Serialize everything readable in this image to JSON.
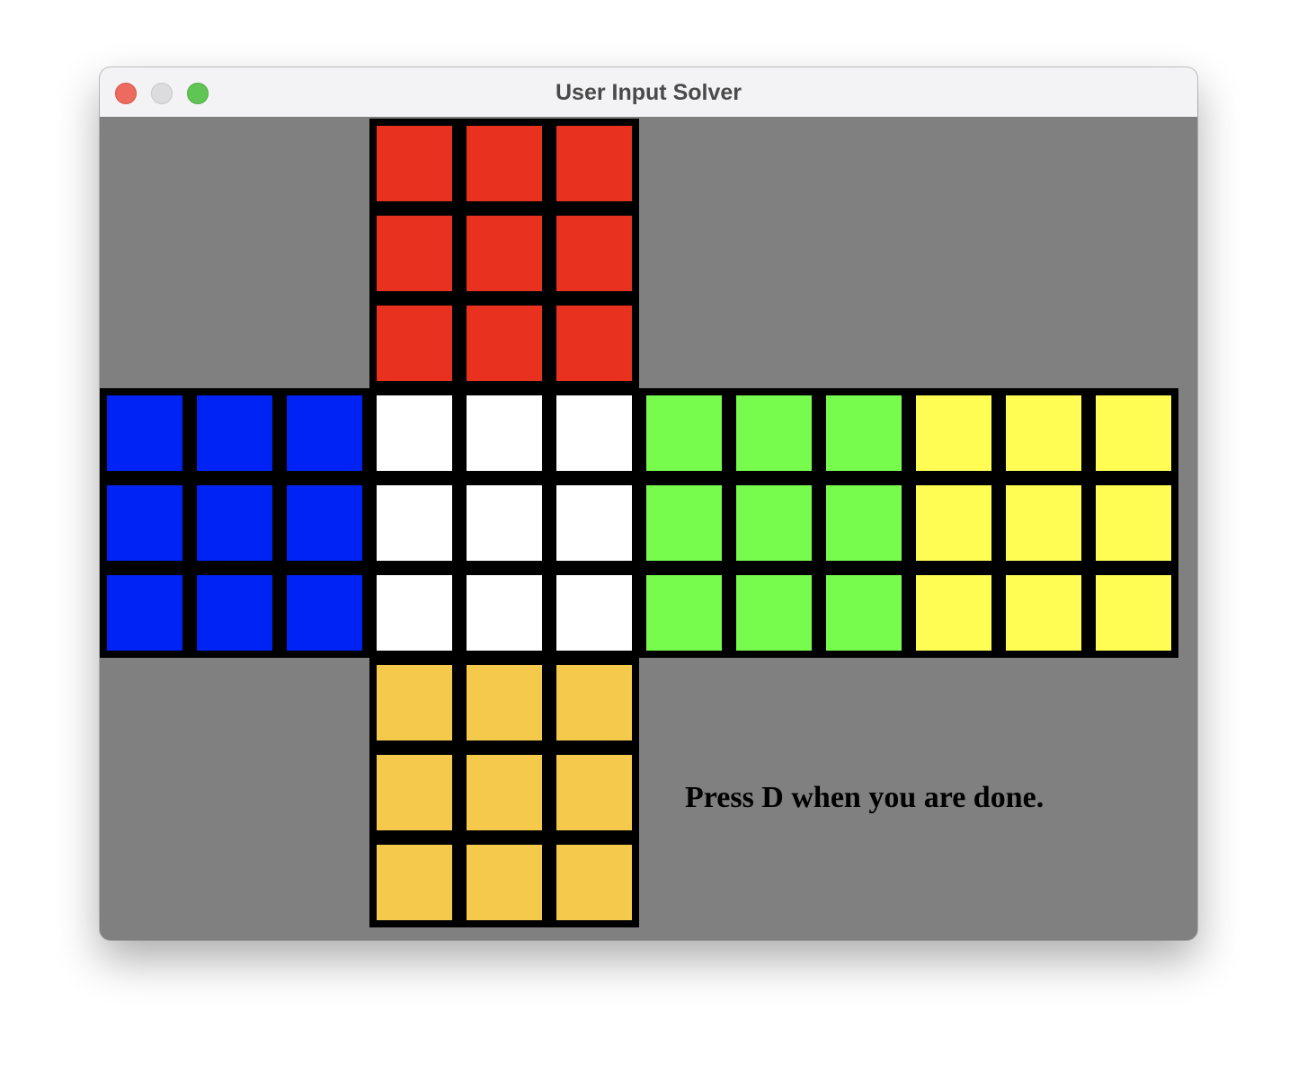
{
  "window": {
    "title": "User Input Solver"
  },
  "instruction": "Press D when you are done.",
  "colors": {
    "red": "#e8321f",
    "blue": "#0023f5",
    "white": "#ffffff",
    "green": "#77fb4d",
    "yellow": "#fffd54",
    "orange": "#f5c94b",
    "background": "#808080",
    "grid": "#000000"
  },
  "faces": {
    "up": [
      "red",
      "red",
      "red",
      "red",
      "red",
      "red",
      "red",
      "red",
      "red"
    ],
    "left": [
      "blue",
      "blue",
      "blue",
      "blue",
      "blue",
      "blue",
      "blue",
      "blue",
      "blue"
    ],
    "front": [
      "white",
      "white",
      "white",
      "white",
      "white",
      "white",
      "white",
      "white",
      "white"
    ],
    "right": [
      "green",
      "green",
      "green",
      "green",
      "green",
      "green",
      "green",
      "green",
      "green"
    ],
    "back": [
      "yellow",
      "yellow",
      "yellow",
      "yellow",
      "yellow",
      "yellow",
      "yellow",
      "yellow",
      "yellow"
    ],
    "down": [
      "orange",
      "orange",
      "orange",
      "orange",
      "orange",
      "orange",
      "orange",
      "orange",
      "orange"
    ]
  }
}
